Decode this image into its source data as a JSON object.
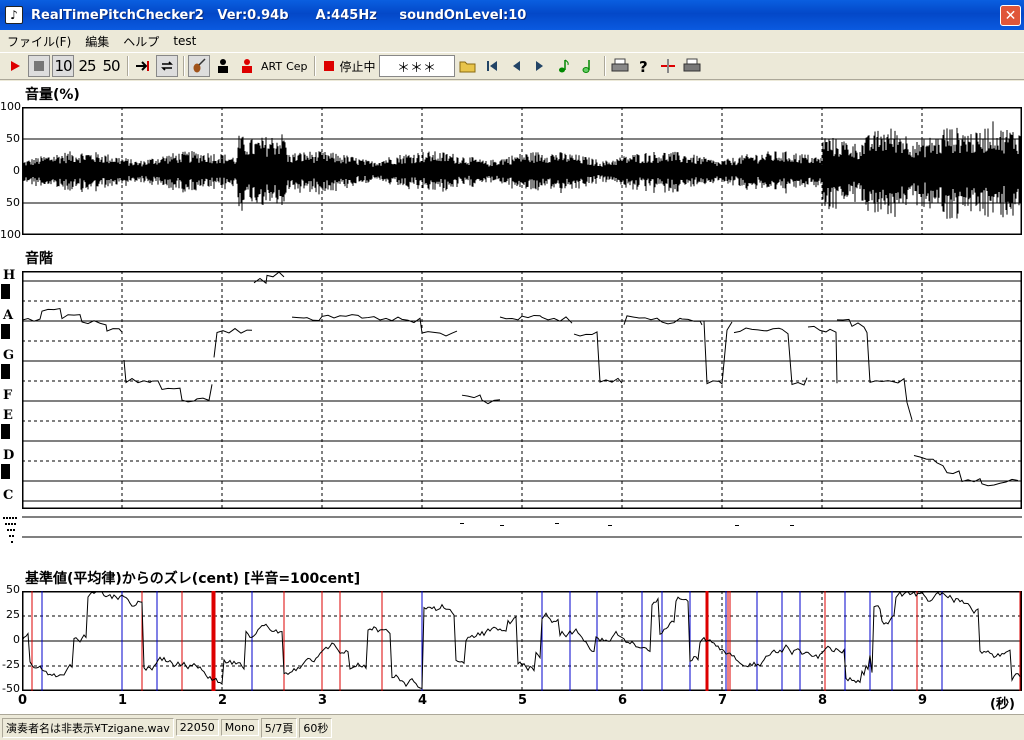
{
  "window": {
    "title": "RealTimePitchChecker2   Ver:0.94b      A:445Hz     soundOnLevel:10",
    "close_icon": "close-icon"
  },
  "menu": [
    "ファイル(F)",
    "編集",
    "ヘルプ",
    "test"
  ],
  "toolbar": {
    "play_icon": "play-icon",
    "stop_icon": "stop-icon",
    "range_buttons": [
      "10",
      "25",
      "50"
    ],
    "stop_status_label": "停止中",
    "display_field": "＊＊＊",
    "art_label": "ART",
    "cep_label": "Cep"
  },
  "volume_panel": {
    "title": "音量(%)",
    "y_ticks": [
      "100",
      "50",
      "0",
      "50",
      "100"
    ]
  },
  "scale_panel": {
    "title": "音階",
    "notes": [
      "H",
      "A",
      "G",
      "F",
      "E",
      "D",
      "C"
    ]
  },
  "deviation_panel": {
    "title": "基準値(平均律)からのズレ(cent) [半音=100cent]",
    "y_ticks": [
      "50",
      "25",
      "0",
      "-25",
      "-50"
    ]
  },
  "time_axis": {
    "labels": [
      "0",
      "1",
      "2",
      "3",
      "4",
      "5",
      "6",
      "7",
      "8",
      "9"
    ],
    "unit": "(秒)"
  },
  "statusbar": [
    "演奏者名は非表示¥Tzigane.wav",
    "22050",
    "Mono",
    "5/7頁",
    "60秒"
  ],
  "colors": {
    "blue_marker": "#0000cc",
    "red_marker": "#dd0000"
  }
}
